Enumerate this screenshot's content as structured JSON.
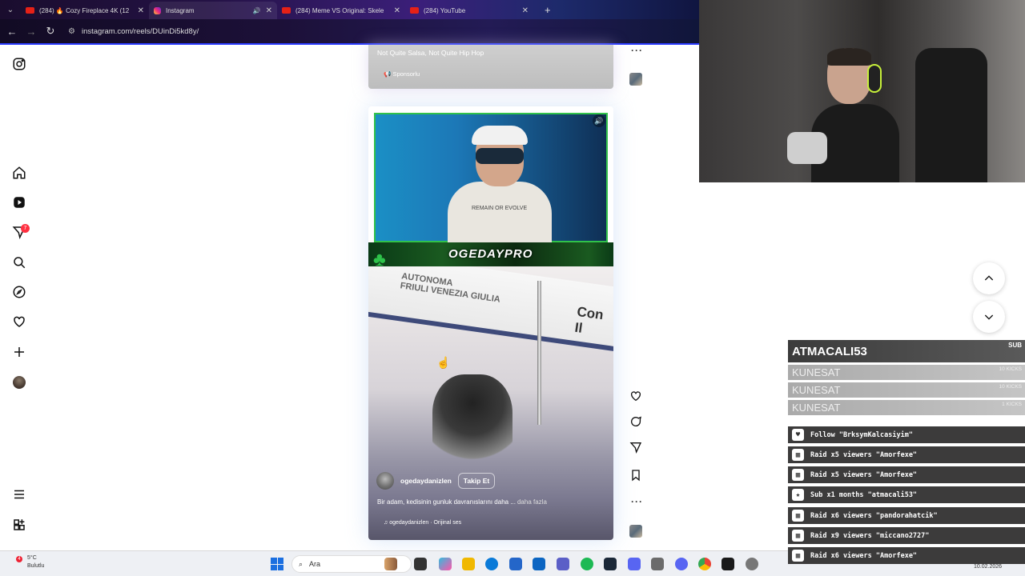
{
  "browser": {
    "tabs": [
      {
        "title": "(284) 🔥 Cozy Fireplace 4K (12",
        "type": "youtube",
        "active": false
      },
      {
        "title": "Instagram",
        "type": "instagram",
        "active": true
      },
      {
        "title": "(284) Meme VS Original: Skele",
        "type": "youtube",
        "active": false
      },
      {
        "title": "(284) YouTube",
        "type": "youtube",
        "active": false
      }
    ],
    "url": "instagram.com/reels/DUinDi5kd8y/"
  },
  "instagram": {
    "notification_count": "7",
    "previous_reel": {
      "title": "Not Quite Salsa, Not Quite Hip Hop",
      "sponsored_label": "Sponsorlu"
    },
    "current_reel": {
      "overlay_channel_name": "OGEDAYPRO",
      "shirt_text": "REMAIN OR EVOLVE",
      "board_text_1": "AUTONOMA\nFRIULI VENEZIA GIULIA",
      "board_text_2": "Con Il",
      "username": "ogedaydanizlen",
      "follow_label": "Takip Et",
      "caption": "Bir adam, kedisinin gunluk davranıslarını daha ...",
      "more_label": "daha fazla",
      "audio": "ogedaydanizlen · Orijinal ses"
    }
  },
  "stream_overlay": {
    "sub": {
      "name": "ATMACALI53",
      "tag": "SUB"
    },
    "kicks": [
      {
        "name": "KUNESAT",
        "amount": "10 KICKS"
      },
      {
        "name": "KUNESAT",
        "amount": "10 KICKS"
      },
      {
        "name": "KUNESAT",
        "amount": "1 KICKS"
      }
    ],
    "alerts": [
      {
        "icon": "heart-icon",
        "glyph": "♥",
        "text": "Follow \"BrksymKalcasiyim\""
      },
      {
        "icon": "raid-icon",
        "glyph": "▦",
        "text": "Raid x5 viewers \"Amorfexe\""
      },
      {
        "icon": "raid-icon",
        "glyph": "▦",
        "text": "Raid x5 viewers \"Amorfexe\""
      },
      {
        "icon": "star-icon",
        "glyph": "★",
        "text": "Sub x1 months \"atmacali53\""
      },
      {
        "icon": "raid-icon",
        "glyph": "▦",
        "text": "Raid x6 viewers \"pandorahatcik\""
      },
      {
        "icon": "raid-icon",
        "glyph": "▦",
        "text": "Raid x9 viewers \"miccano2727\""
      },
      {
        "icon": "raid-icon",
        "glyph": "▦",
        "text": "Raid x6 viewers \"Amorfexe\""
      }
    ]
  },
  "taskbar": {
    "weather_badge": "4",
    "temperature": "5°C",
    "condition": "Bulutlu",
    "search_placeholder": "Ara",
    "date": "10.02.2026"
  },
  "colors": {
    "accent_blue": "#2b3cff",
    "notification_red": "#ff3040",
    "overlay_green": "#31c24a"
  }
}
